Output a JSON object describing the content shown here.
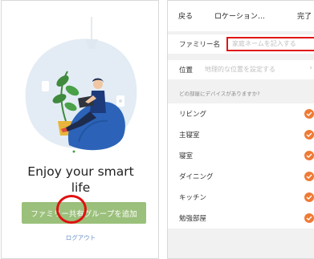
{
  "left": {
    "headline_line1": "Enjoy your smart",
    "headline_line2": "life",
    "cta_label": "ファミリー共有グループを追加",
    "logout_label": "ログアウト",
    "accent": "#9bc07b"
  },
  "right": {
    "nav": {
      "back": "戻る",
      "title": "ロケーション…",
      "done": "完了"
    },
    "family_label": "ファミリー名",
    "family_placeholder": "家庭ネームを記入する",
    "location_label": "位置",
    "location_placeholder": "地理的な位置を設定する",
    "section_title": "どの部屋にデバイスがありますか?",
    "rooms": [
      "リビング",
      "主寝室",
      "寝室",
      "ダイニング",
      "キッチン",
      "勉強部屋"
    ],
    "check_color": "#ef7a34"
  }
}
